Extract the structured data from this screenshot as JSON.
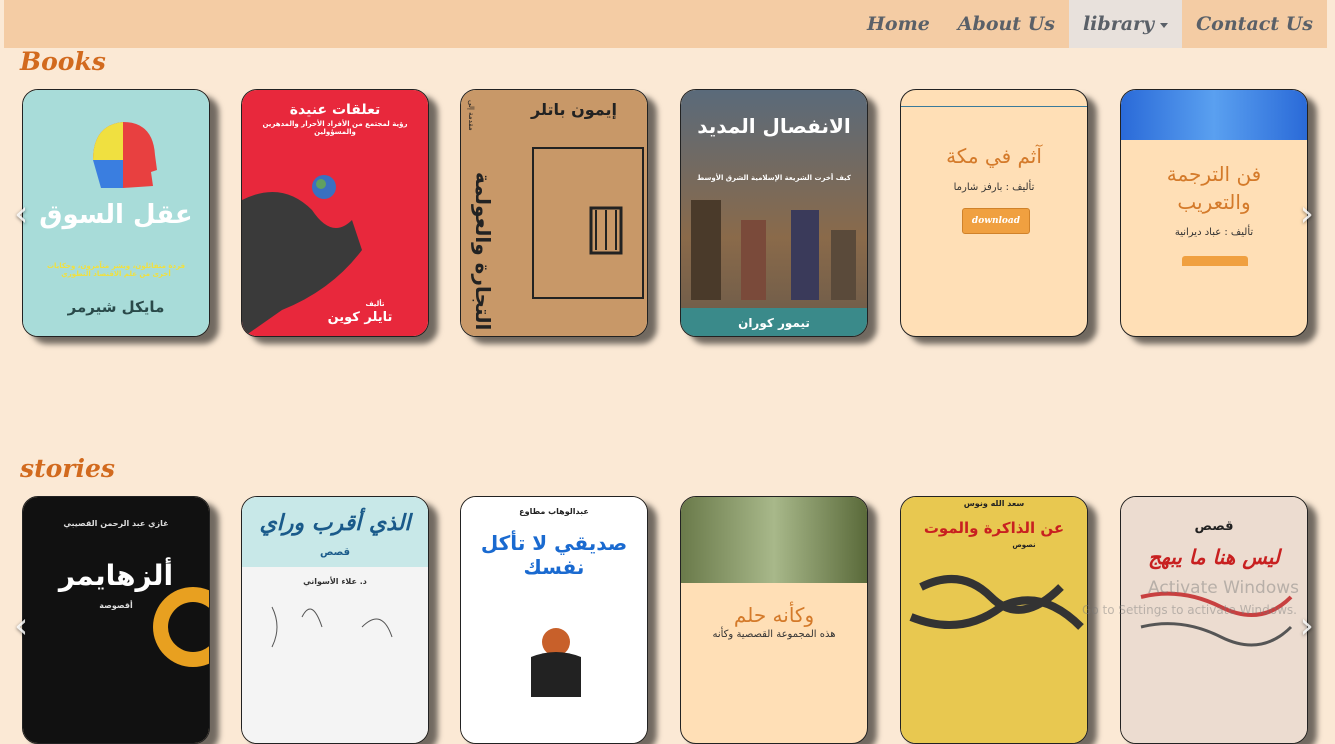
{
  "nav": {
    "items": [
      {
        "label": "Home"
      },
      {
        "label": "About Us"
      },
      {
        "label": "library"
      },
      {
        "label": "Contact Us"
      }
    ]
  },
  "sections": {
    "books": {
      "title": "Books",
      "cards": [
        {
          "title": "عقل السوق",
          "author": "مايكل شيرمر",
          "blurb": "قردة متفائلون، وبشر متآمرون، وحكايات أخرى من علم الاقتصاد التطوري"
        },
        {
          "title": "تعلقات عنيدة",
          "subtitle": "رؤية لمجتمع من الأفراد الأحرار والمدهرين والمسؤولين",
          "author_prefix": "تأليف",
          "author": "تايلر كوين"
        },
        {
          "title": "التجارة والعولمة",
          "prefix": "مقدمة إلى",
          "author": "إيمون باتلر"
        },
        {
          "title": "الانفصال المديد",
          "subtitle": "كيف أخرت الشريعة الإسلامية الشرق الأوسط",
          "author": "تيمور كوران"
        },
        {
          "title": "آثم في مكة",
          "author": "تأليف : بارفز شارما",
          "button": "download"
        },
        {
          "title": "فن الترجمة والتعريب",
          "author": "تأليف : عباد ديرانية"
        }
      ]
    },
    "stories": {
      "title": "stories",
      "cards": [
        {
          "title": "ألزهايمر",
          "author": "غازي عبد الرحمن القصيبي",
          "subtitle": "أقصوصة"
        },
        {
          "title": "الذي أقرب وراي",
          "subtitle": "قصص",
          "author": "د. علاء الأسواني"
        },
        {
          "title": "صديقي لا تأكل نفسك",
          "author": "عبدالوهاب مطاوع"
        },
        {
          "title": "وكأنه حلم",
          "blurb": "هذه المجموعة القصصية وكأنه"
        },
        {
          "title": "عن الذاكرة والموت",
          "author": "سعد الله ونوس",
          "subtitle": "نصوص"
        },
        {
          "title": "ليس هنا ما يبهج",
          "prefix": "قصص"
        }
      ]
    }
  },
  "watermark": {
    "line1": "Activate Windows",
    "line2": "Go to Settings to activate Windows."
  }
}
